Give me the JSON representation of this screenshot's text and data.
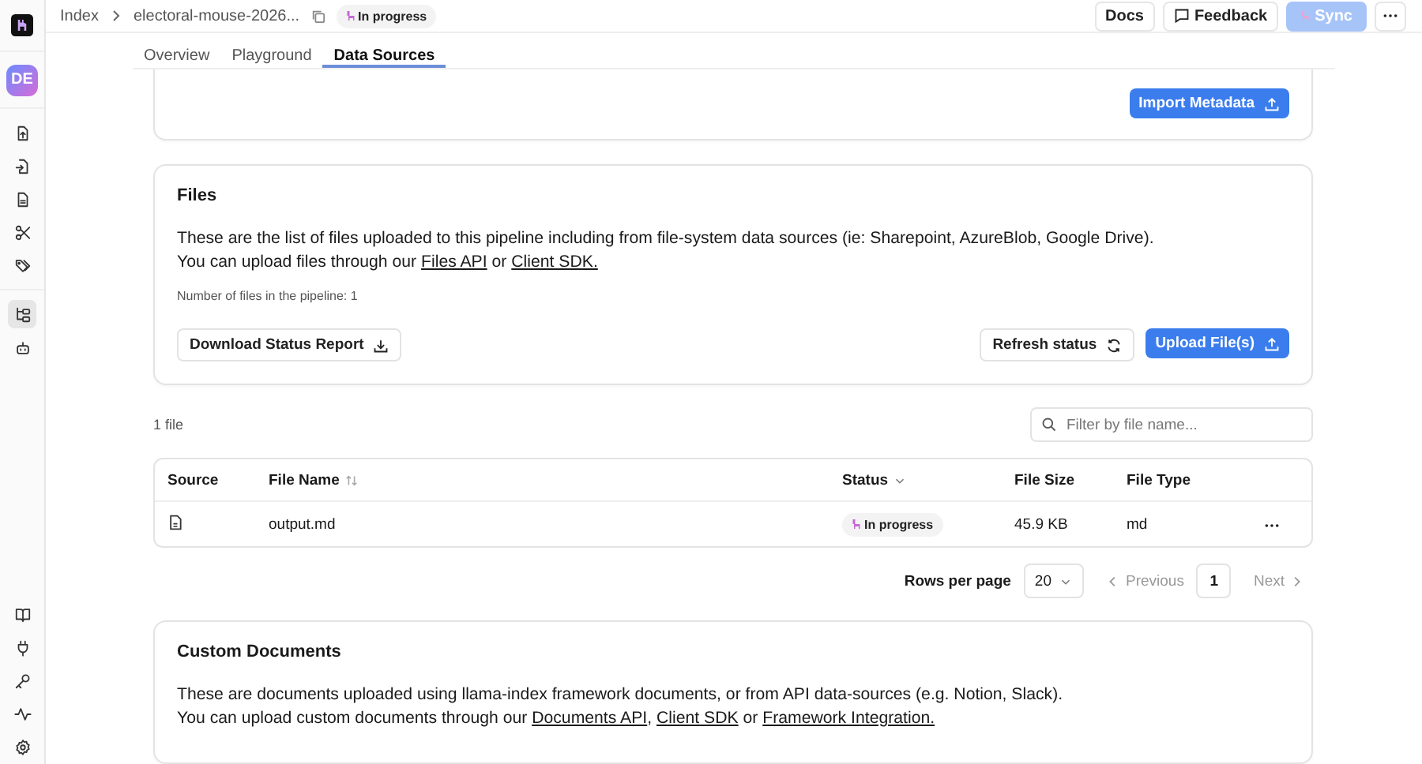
{
  "breadcrumb": {
    "root": "Index",
    "project": "electoral-mouse-2026...",
    "status": "In progress"
  },
  "header_buttons": {
    "docs": "Docs",
    "feedback": "Feedback",
    "sync": {
      "label": "Sync",
      "disabled": true
    }
  },
  "avatar": "DE",
  "sidebar": {
    "top": [
      {
        "kind": "file-up",
        "selected": false
      },
      {
        "kind": "file-in",
        "selected": false
      },
      {
        "kind": "file",
        "selected": false
      },
      {
        "kind": "scissors",
        "selected": false
      },
      {
        "kind": "tags",
        "selected": false
      }
    ],
    "middle": [
      {
        "kind": "workflow",
        "selected": true
      },
      {
        "kind": "bot",
        "selected": false
      }
    ],
    "bottom": [
      {
        "kind": "book",
        "selected": false
      },
      {
        "kind": "plug",
        "selected": false
      },
      {
        "kind": "key",
        "selected": false
      },
      {
        "kind": "activity",
        "selected": false
      },
      {
        "kind": "gear",
        "selected": false
      }
    ]
  },
  "tabs": [
    {
      "label": "Overview",
      "selected": false
    },
    {
      "label": "Playground",
      "selected": false
    },
    {
      "label": "Data Sources",
      "selected": true
    }
  ],
  "metadata_card": {
    "button": "Import Metadata"
  },
  "files_card": {
    "title": "Files",
    "lines": [
      [
        {
          "text": "These are the list of files uploaded to this pipeline including from file-system data sources (ie: Sharepoint, AzureBlob, Google Drive).",
          "link": false
        }
      ],
      [
        {
          "text": "You can upload files through our ",
          "link": false
        },
        {
          "text": "Files API",
          "link": true
        },
        {
          "text": " or ",
          "link": false
        },
        {
          "text": "Client SDK.",
          "link": true
        }
      ]
    ],
    "count": "Number of files in the pipeline: 1",
    "download": "Download Status Report",
    "refresh": "Refresh status",
    "upload": "Upload File(s)"
  },
  "file_count": "1 file",
  "filter": {
    "placeholder": "Filter by file name..."
  },
  "table": {
    "columns": [
      "Source",
      "File Name",
      "Status",
      "File Size",
      "File Type"
    ],
    "rows": [
      {
        "file_name": "output.md",
        "status": "In progress",
        "file_size": "45.9 KB",
        "file_type": "md"
      }
    ]
  },
  "pagination": {
    "rows_label": "Rows per page",
    "rows_value": "20",
    "previous": "Previous",
    "page": "1",
    "next": "Next"
  },
  "custom_card": {
    "title": "Custom Documents",
    "lines": [
      [
        {
          "text": "These are documents uploaded using llama-index framework documents, or from API data-sources (e.g. Notion, Slack).",
          "link": false
        }
      ],
      [
        {
          "text": "You can upload custom documents through our ",
          "link": false
        },
        {
          "text": "Documents API",
          "link": true
        },
        {
          "text": ", ",
          "link": false
        },
        {
          "text": "Client SDK",
          "link": true
        },
        {
          "text": " or ",
          "link": false
        },
        {
          "text": "Framework Integration.",
          "link": true
        }
      ]
    ]
  }
}
